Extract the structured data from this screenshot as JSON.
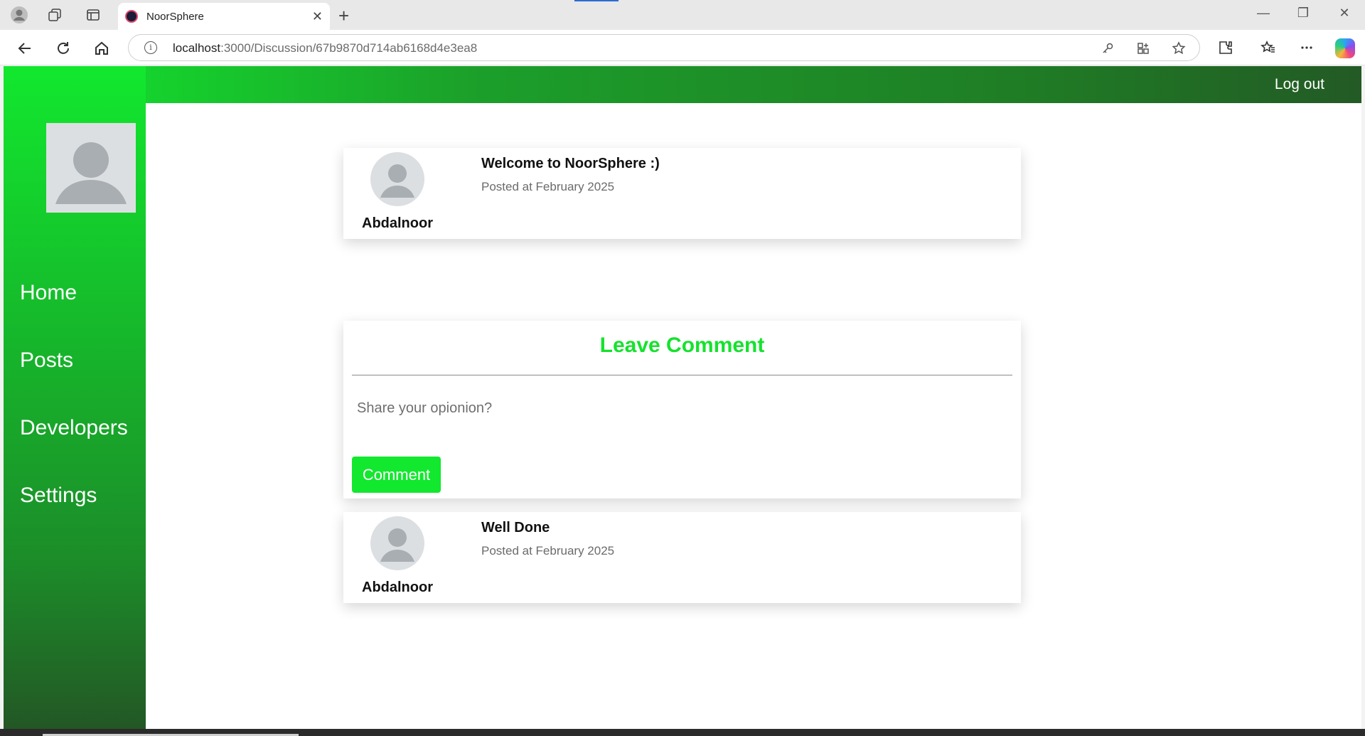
{
  "browser": {
    "tab_title": "NoorSphere",
    "url_host": "localhost",
    "url_path": ":3000/Discussion/67b9870d714ab6168d4e3ea8"
  },
  "app": {
    "logout_label": "Log out",
    "nav": [
      {
        "label": "Home"
      },
      {
        "label": "Posts"
      },
      {
        "label": "Developers"
      },
      {
        "label": "Settings"
      }
    ]
  },
  "post": {
    "author": "Abdalnoor",
    "title": "Welcome to NoorSphere :)",
    "date": "Posted at February 2025"
  },
  "comment_form": {
    "heading": "Leave Comment",
    "placeholder": "Share your opionion?",
    "button_label": "Comment"
  },
  "comments": [
    {
      "author": "Abdalnoor",
      "text": "Well Done",
      "date": "Posted at February 2025"
    }
  ],
  "colors": {
    "accent": "#12e82e",
    "accent_dark": "#235725"
  }
}
